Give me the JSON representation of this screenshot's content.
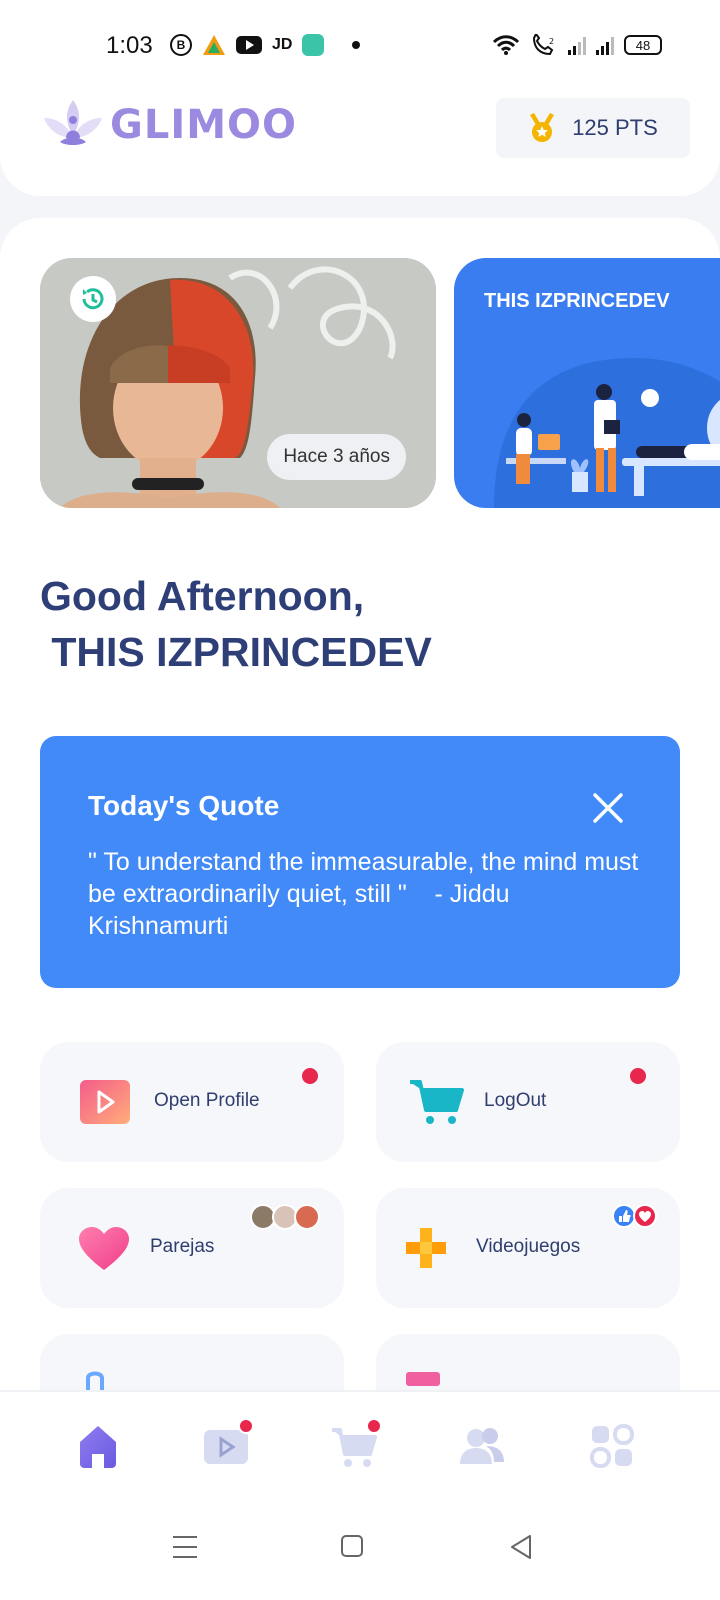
{
  "status_bar": {
    "time": "1:03",
    "carrier_badge": "JD",
    "battery": "48",
    "icons": [
      "b-icon",
      "app-triangle-icon",
      "youtube-icon",
      "jd-icon",
      "chat-app-icon",
      "notification-dot",
      "wifi-icon",
      "volte-icon",
      "signal-icon",
      "signal-icon",
      "battery-icon"
    ]
  },
  "header": {
    "app_name": "GLIMOO",
    "points": "125 PTS"
  },
  "carousel": {
    "card1": {
      "badge": "Hace 3 años",
      "icon": "history-icon"
    },
    "card2": {
      "title": "THIS IZPRINCEDEV"
    }
  },
  "greeting": {
    "text": "Good Afternoon,\n THIS IZPRINCEDEV"
  },
  "quote": {
    "title": "Today's Quote",
    "text": "\" To understand the immeasurable, the mind must be extraordinarily quiet, still \"    - Jiddu Krishnamurti"
  },
  "tiles": [
    {
      "label": "Open Profile",
      "icon": "play-icon",
      "has_dot": true
    },
    {
      "label": "LogOut",
      "icon": "cart-icon",
      "has_dot": true
    },
    {
      "label": "Parejas",
      "icon": "heart-icon",
      "has_dot": false
    },
    {
      "label": "Videojuegos",
      "icon": "gamepad-icon",
      "has_dot": false
    }
  ],
  "bottom_nav": [
    "home-icon",
    "video-icon",
    "cart-icon",
    "people-icon",
    "grid-icon"
  ],
  "colors": {
    "accent": "#428af7",
    "brand": "#9b8ae0",
    "heading": "#2e3f78",
    "badge_red": "#e8274d"
  }
}
